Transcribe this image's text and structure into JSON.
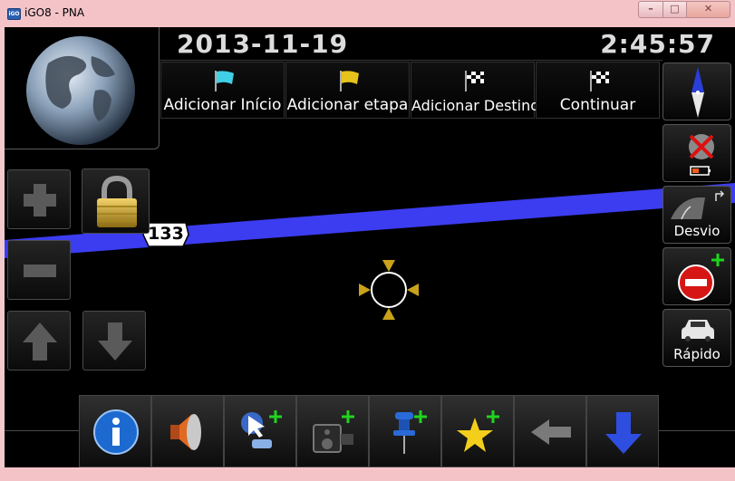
{
  "window": {
    "title": "iGO8 - PNA",
    "app_icon_text": "iGO"
  },
  "header": {
    "date": "2013-11-19",
    "time": "2:45:57"
  },
  "top_buttons": [
    {
      "label": "Adicionar Início",
      "flag_color": "#3fd0e6"
    },
    {
      "label": "Adicionar etapa",
      "flag_color": "#e6c21a"
    },
    {
      "label": "Adicionar Destino",
      "flag_color": "checkered"
    },
    {
      "label": "Continuar",
      "flag_color": "checkered"
    }
  ],
  "right_buttons": [
    {
      "name": "compass",
      "label": ""
    },
    {
      "name": "gps-battery-status",
      "label": ""
    },
    {
      "name": "detour",
      "label": "Desvio"
    },
    {
      "name": "avoid",
      "label": ""
    },
    {
      "name": "fastest-route",
      "label": "Rápido"
    }
  ],
  "map": {
    "route_color": "#3c3cf0",
    "road_shield": "133"
  },
  "bottom_buttons": [
    "info-icon",
    "volume-icon",
    "add-poi-icon",
    "add-camera-icon",
    "add-pin-icon",
    "add-favorite-icon",
    "back-icon",
    "down-icon"
  ]
}
